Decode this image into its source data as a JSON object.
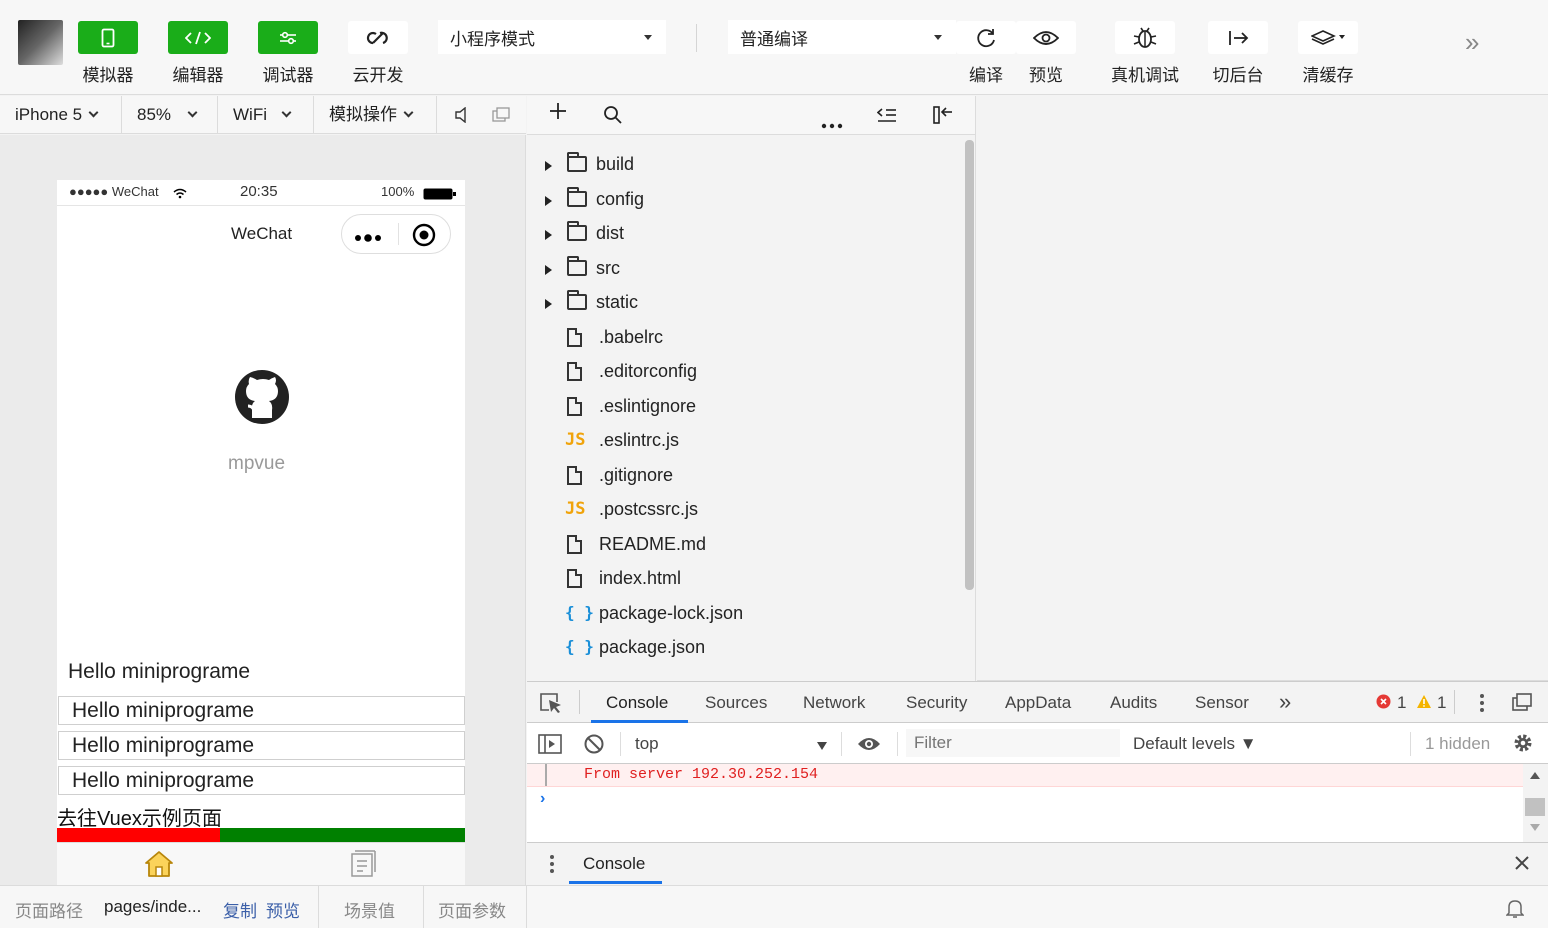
{
  "toolbar": {
    "simulator": "模拟器",
    "editor": "编辑器",
    "debugger": "调试器",
    "cloud": "云开发",
    "mode_select": "小程序模式",
    "compile_select": "普通编译",
    "compile": "编译",
    "preview": "预览",
    "remote_debug": "真机调试",
    "background": "切后台",
    "clear_cache": "清缓存"
  },
  "simbar": {
    "device": "iPhone 5",
    "zoom": "85%",
    "network": "WiFi",
    "operations": "模拟操作"
  },
  "phone": {
    "status_signal": "●●●●● WeChat",
    "status_time": "20:35",
    "status_battery": "100%",
    "nav_title": "WeChat",
    "logo_caption": "mpvue",
    "hello_text": "Hello miniprograme",
    "inputs": [
      "Hello miniprograme",
      "Hello miniprograme",
      "Hello miniprograme"
    ],
    "vuex_link": "去往Vuex示例页面"
  },
  "tree": {
    "folders": [
      "build",
      "config",
      "dist",
      "src",
      "static"
    ],
    "files": [
      {
        "name": ".babelrc",
        "type": "file"
      },
      {
        "name": ".editorconfig",
        "type": "file"
      },
      {
        "name": ".eslintignore",
        "type": "file"
      },
      {
        "name": ".eslintrc.js",
        "type": "js"
      },
      {
        "name": ".gitignore",
        "type": "file"
      },
      {
        "name": ".postcssrc.js",
        "type": "js"
      },
      {
        "name": "README.md",
        "type": "file"
      },
      {
        "name": "index.html",
        "type": "file"
      },
      {
        "name": "package-lock.json",
        "type": "json"
      },
      {
        "name": "package.json",
        "type": "json"
      }
    ],
    "js_badge": "JS",
    "json_badge": "{ }"
  },
  "devtools": {
    "tabs": [
      "Console",
      "Sources",
      "Network",
      "Security",
      "AppData",
      "Audits",
      "Sensor"
    ],
    "error_count": "1",
    "warning_count": "1",
    "context": "top",
    "filter_placeholder": "Filter",
    "levels": "Default levels ▼",
    "hidden": "1 hidden",
    "error_message": "From server 192.30.252.154",
    "drawer_tab": "Console"
  },
  "bottom": {
    "path_label": "页面路径",
    "path_value": "pages/inde...",
    "copy": "复制",
    "preview": "预览",
    "scene": "场景值",
    "params": "页面参数"
  }
}
